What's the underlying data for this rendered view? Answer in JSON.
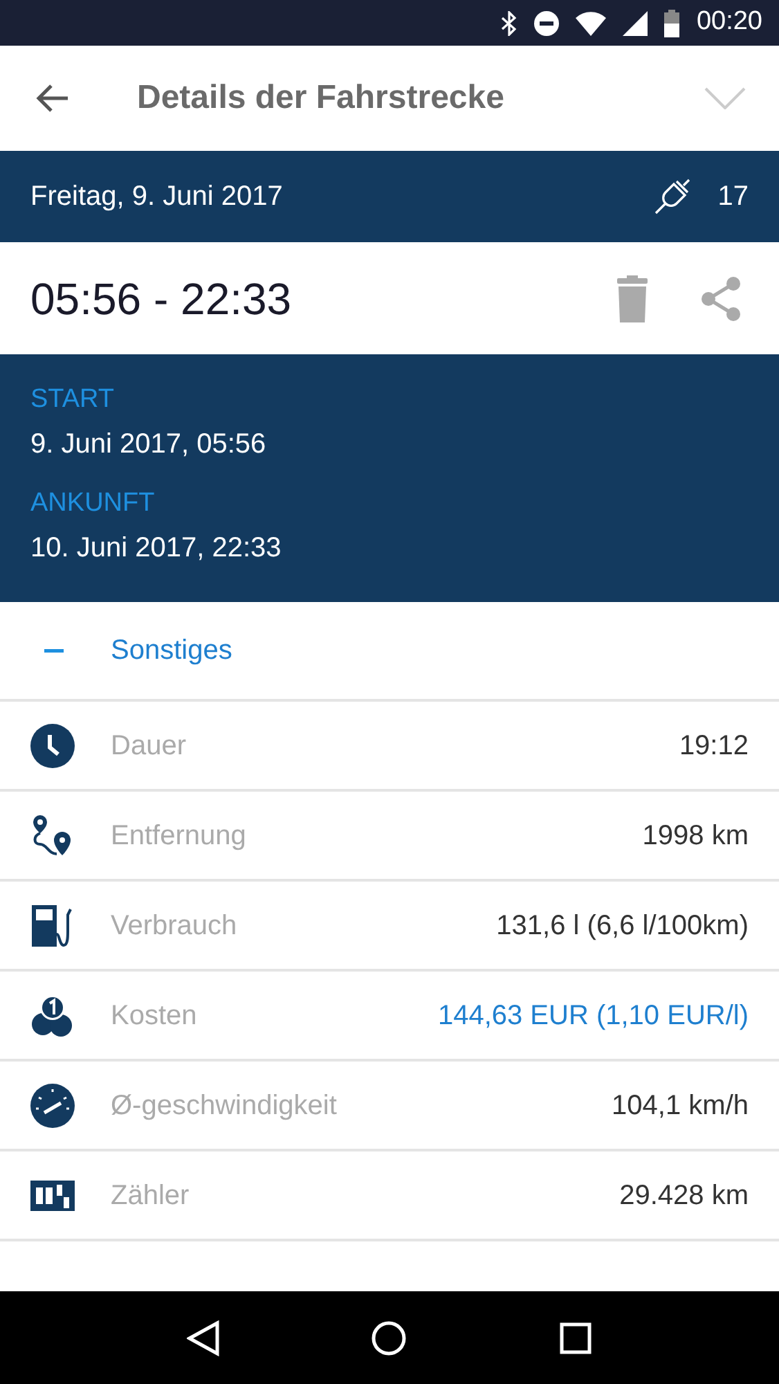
{
  "status_bar": {
    "time": "00:20"
  },
  "app_bar": {
    "title": "Details der Fahrstrecke"
  },
  "date_bar": {
    "date": "Freitag, 9. Juni 2017",
    "count": "17"
  },
  "time_range": "05:56 - 22:33",
  "trip": [
    {
      "label": "START",
      "value": "9. Juni 2017, 05:56"
    },
    {
      "label": "ANKUNFT",
      "value": "10. Juni 2017, 22:33"
    }
  ],
  "section": {
    "title": "Sonstiges",
    "expanded": true
  },
  "rows": [
    {
      "kind": "clock",
      "label": "Dauer",
      "value": "19:12",
      "highlight": false
    },
    {
      "kind": "route",
      "label": "Entfernung",
      "value": "1998 km",
      "highlight": false
    },
    {
      "kind": "fuel",
      "label": "Verbrauch",
      "value": "131,6 l (6,6 l/100km)",
      "highlight": false
    },
    {
      "kind": "cost",
      "label": "Kosten",
      "value": "144,63 EUR (1,10 EUR/l)",
      "highlight": true
    },
    {
      "kind": "speed",
      "label": "Ø-geschwindigkeit",
      "value": "104,1 km/h",
      "highlight": false
    },
    {
      "kind": "counter",
      "label": "Zähler",
      "value": "29.428 km",
      "highlight": false
    }
  ]
}
